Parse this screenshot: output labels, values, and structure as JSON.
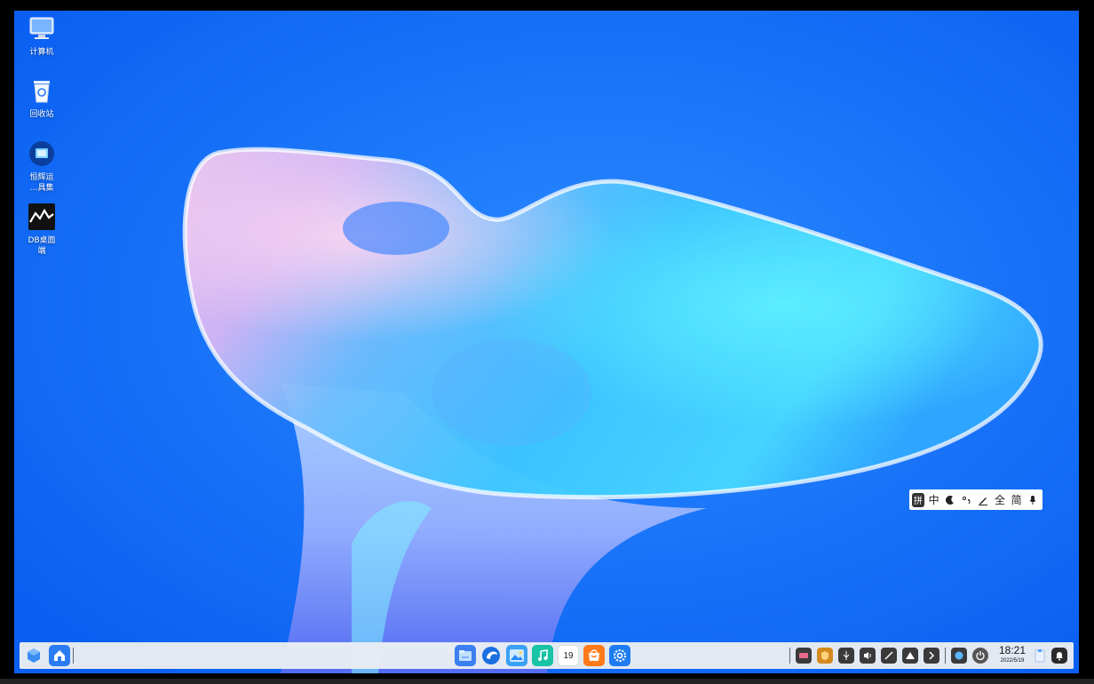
{
  "desktop": {
    "icons": [
      {
        "label": "计算机",
        "icon": "computer-icon"
      },
      {
        "label": "回收站",
        "icon": "trash-icon"
      },
      {
        "label": "恒辉运\n…具集",
        "icon": "toolkit-icon"
      },
      {
        "label": "DB桌面\n端",
        "icon": "db-desktop-icon"
      }
    ]
  },
  "ime": {
    "mode": "拼",
    "chinese": "中",
    "fullwidth": "全",
    "simplified": "简",
    "icons": [
      "moon-icon",
      "punctuation-icon",
      "pen-icon",
      "microphone-icon"
    ]
  },
  "taskbar": {
    "left_icons": [
      "cube-launcher-icon",
      "home-icon"
    ],
    "center_apps": [
      "file-manager-icon",
      "browser-icon",
      "gallery-icon",
      "music-icon",
      "calendar-icon",
      "app-store-icon",
      "settings-icon"
    ],
    "calendar_day": "19",
    "tray_icons": [
      "keyboard-tray-icon",
      "security-tray-icon",
      "usb-tray-icon",
      "volume-tray-icon",
      "tools-tray-icon",
      "triangle-tray-icon",
      "chevron-right-tray-icon",
      "network-tray-icon",
      "power-tray-icon"
    ],
    "time": "18:21",
    "date": "2022/5/19",
    "notification_icon": "bell-icon",
    "clipboard_icon": "clipboard-icon"
  },
  "colors": {
    "wallpaper_primary": "#0a6cff",
    "wallpaper_glow": "#38d6ff",
    "taskbar_bg": "#ebeef3"
  }
}
